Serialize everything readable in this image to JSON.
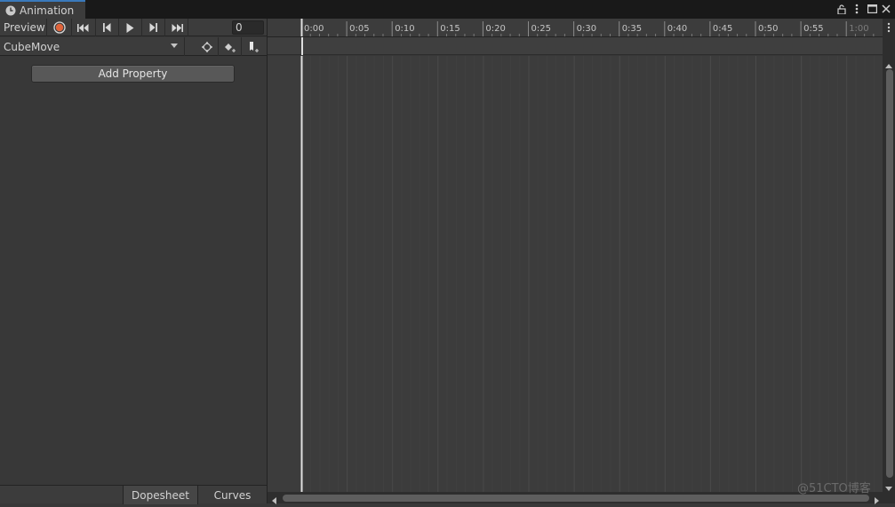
{
  "window": {
    "tab_title": "Animation",
    "header_icons": [
      "lock-icon",
      "kebab-menu-icon",
      "maximize-icon",
      "close-icon"
    ]
  },
  "toolbar": {
    "preview_label": "Preview",
    "controls": [
      "record-icon",
      "first-keyframe-icon",
      "previous-frame-icon",
      "play-icon",
      "next-frame-icon",
      "last-keyframe-icon"
    ],
    "frame_value": "0",
    "record_color": "#e0643b"
  },
  "clip": {
    "selected": "CubeMove",
    "buttons": [
      "filter-keyframes-icon",
      "add-keyframe-icon",
      "add-event-icon"
    ]
  },
  "properties": {
    "add_property_label": "Add Property"
  },
  "views": {
    "tabs": [
      "Dopesheet",
      "Curves"
    ]
  },
  "timeline": {
    "tick_labels": [
      "0:00",
      "0:05",
      "0:10",
      "0:15",
      "0:20",
      "0:25",
      "0:30",
      "0:35",
      "0:40",
      "0:45",
      "0:50",
      "0:55",
      "1:00"
    ],
    "playhead_label": "0:00"
  },
  "watermark": "@51CTO博客",
  "colors": {
    "accent": "#3a79bb",
    "background": "#383838"
  }
}
